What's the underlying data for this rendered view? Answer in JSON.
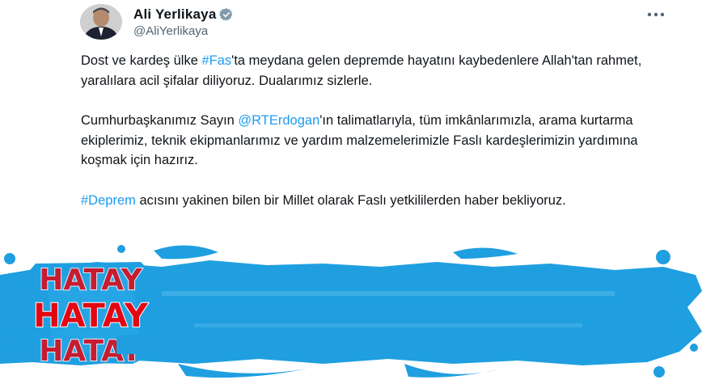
{
  "tweet": {
    "author": {
      "display_name": "Ali Yerlikaya",
      "handle": "@AliYerlikaya",
      "verified": true
    },
    "paragraphs": [
      [
        {
          "t": "Dost ve kardeş ülke ",
          "link": false
        },
        {
          "t": "#Fas",
          "link": true
        },
        {
          "t": "'ta meydana gelen depremde hayatını kaybedenlere Allah'tan rahmet, yaralılara acil şifalar diliyoruz. Dualarımız sizlerle.",
          "link": false
        }
      ],
      [
        {
          "t": "Cumhurbaşkanımız Sayın ",
          "link": false
        },
        {
          "t": "@RTErdogan",
          "link": true
        },
        {
          "t": "'ın talimatlarıyla, tüm imkânlarımızla, arama kurtarma ekiplerimiz, teknik ekipmanlarımız ve yardım malzemelerimizle Faslı kardeşlerimizin yardımına koşmak için hazırız.",
          "link": false
        }
      ],
      [
        {
          "t": "#Deprem",
          "link": true
        },
        {
          "t": " acısını yakinen bilen bir Millet olarak Faslı yetkililerden haber bekliyoruz.",
          "link": false
        }
      ]
    ]
  },
  "overlay": {
    "logo_text": "HATAY",
    "colors": {
      "splash": "#1f9fe0",
      "logo_red": "#e30613",
      "link": "#1d9bf0"
    }
  },
  "icons": {
    "verified": "verified-badge-icon",
    "more": "more-options-icon"
  }
}
